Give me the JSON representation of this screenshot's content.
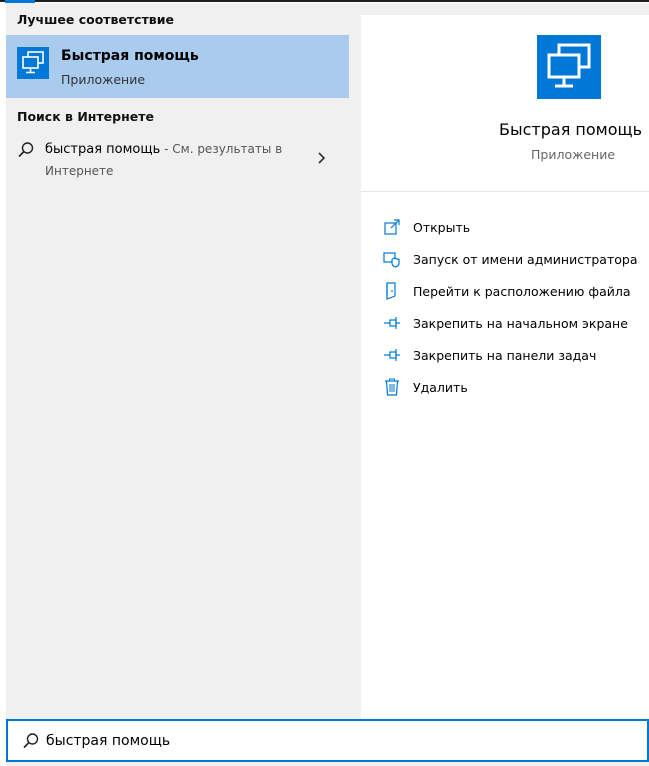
{
  "best_match": {
    "header": "Лучшее соответствие",
    "title": "Быстрая помощь",
    "subtitle": "Приложение",
    "icon": "quick-assist-icon"
  },
  "web": {
    "header": "Поиск в Интернете",
    "query": "быстрая помощь",
    "hint": " - См. результаты в",
    "hint_line2": "Интернете"
  },
  "preview": {
    "title": "Быстрая помощь",
    "subtitle": "Приложение",
    "actions": [
      {
        "label": "Открыть",
        "icon": "open-icon"
      },
      {
        "label": "Запуск от имени администратора",
        "icon": "shield-icon"
      },
      {
        "label": "Перейти к расположению файла",
        "icon": "file-location-icon"
      },
      {
        "label": "Закрепить на начальном экране",
        "icon": "pin-icon"
      },
      {
        "label": "Закрепить на панели задач",
        "icon": "pin-icon"
      },
      {
        "label": "Удалить",
        "icon": "trash-icon"
      }
    ]
  },
  "search": {
    "value": "быстрая помощь"
  },
  "colors": {
    "accent": "#0078d7",
    "selected": "#a9cbee",
    "pane": "#f0f0f0"
  }
}
